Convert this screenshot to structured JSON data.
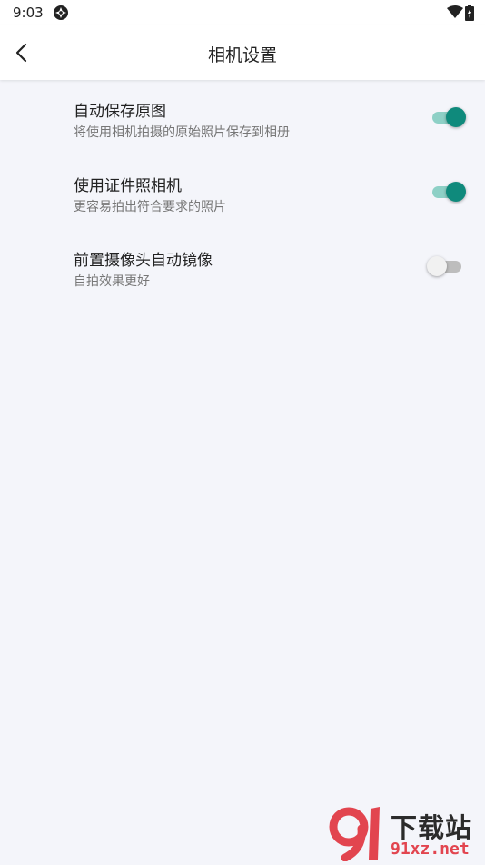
{
  "status_bar": {
    "time": "9:03",
    "app_icon": "app-notification-icon",
    "wifi_icon": "wifi-icon",
    "battery_icon": "battery-charging-icon"
  },
  "header": {
    "title": "相机设置",
    "back_icon": "back-arrow-icon"
  },
  "settings": [
    {
      "title": "自动保存原图",
      "description": "将使用相机拍摄的原始照片保存到相册",
      "enabled": true
    },
    {
      "title": "使用证件照相机",
      "description": "更容易拍出符合要求的照片",
      "enabled": true
    },
    {
      "title": "前置摄像头自动镜像",
      "description": "自拍效果更好",
      "enabled": false
    }
  ],
  "colors": {
    "accent": "#0f8a7c",
    "accent_track": "#8ed0c6",
    "background": "#f4f5fa"
  },
  "watermark": {
    "logo_glyph": "91",
    "text_top": "下载站",
    "text_bottom": "91xz.net"
  }
}
